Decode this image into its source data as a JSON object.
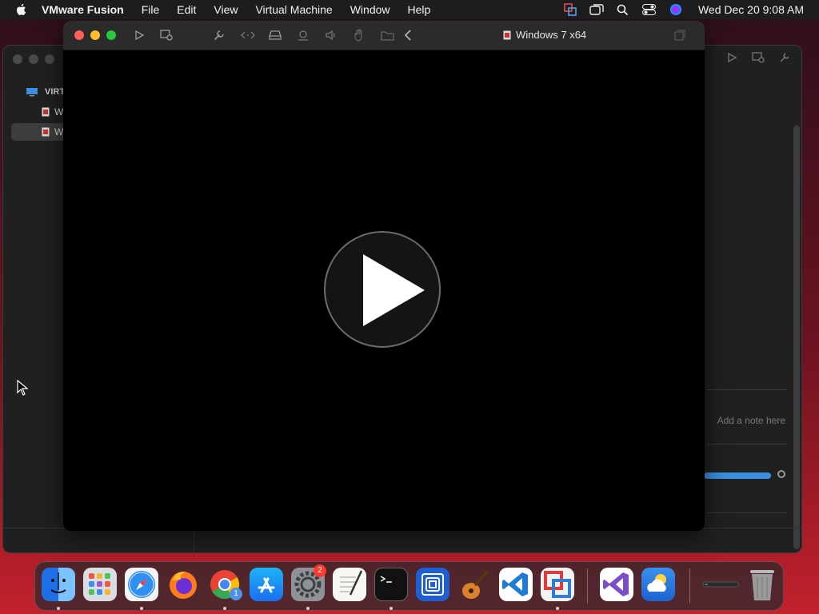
{
  "menubar": {
    "app_name": "VMware Fusion",
    "menus": [
      "File",
      "Edit",
      "View",
      "Virtual Machine",
      "Window",
      "Help"
    ],
    "clock": "Wed Dec 20  9:08 AM"
  },
  "vm_window": {
    "title": "Windows 7 x64"
  },
  "library_window": {
    "section_label": "VIRT",
    "items": [
      {
        "label": "W",
        "selected": false
      },
      {
        "label": "W",
        "selected": true
      }
    ],
    "note_placeholder": "Add a note here",
    "slider_level": 0.95
  },
  "dock": {
    "apps": [
      {
        "name": "finder",
        "running": true
      },
      {
        "name": "launchpad",
        "running": false
      },
      {
        "name": "safari",
        "running": true
      },
      {
        "name": "firefox",
        "running": false
      },
      {
        "name": "chrome",
        "running": true,
        "badge": "1"
      },
      {
        "name": "app-store",
        "running": false
      },
      {
        "name": "system-settings",
        "running": true,
        "badge": "2"
      },
      {
        "name": "textedit",
        "running": false
      },
      {
        "name": "terminal",
        "running": true
      },
      {
        "name": "vmware-fusion",
        "running": false
      },
      {
        "name": "garageband",
        "running": false
      },
      {
        "name": "vscode",
        "running": false
      },
      {
        "name": "vmware-fusion-app",
        "running": true
      },
      {
        "name": "visual-studio",
        "running": false
      },
      {
        "name": "weather",
        "running": false
      },
      {
        "name": "minimized-window",
        "running": false
      },
      {
        "name": "trash",
        "running": false
      }
    ]
  },
  "colors": {
    "close": "#ff5f57",
    "minimize": "#febc2e",
    "zoom": "#28c840",
    "accent": "#3b8fe0"
  }
}
